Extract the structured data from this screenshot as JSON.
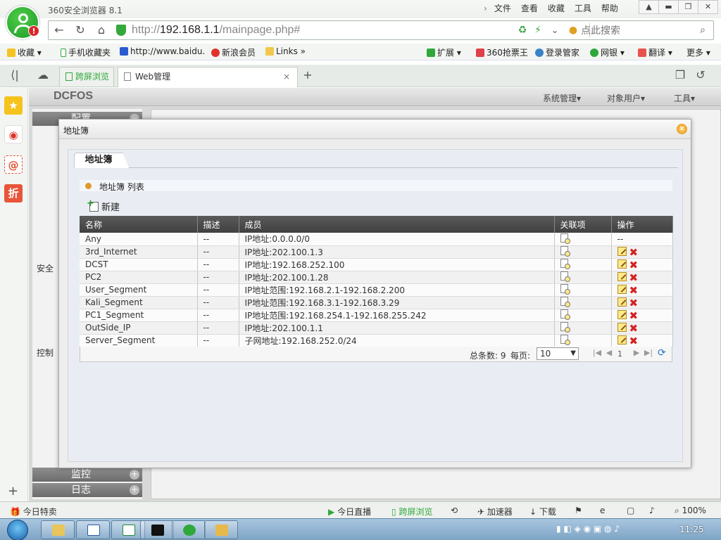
{
  "browser": {
    "title": "360安全浏览器 8.1",
    "menu": [
      "文件",
      "查看",
      "收藏",
      "工具",
      "帮助"
    ],
    "url_prefix": "http://",
    "url_host": "192.168.1.1",
    "url_path": "/mainpage.php#",
    "search_placeholder": "点此搜索"
  },
  "bookmarks": {
    "favorites": "收藏",
    "mobile": "手机收藏夹",
    "baidu": "http://www.baidu.",
    "sina": "新浪会员",
    "links": "Links",
    "extend": "扩展",
    "ticket": "360抢票王",
    "login": "登录管家",
    "bank": "网银",
    "translate": "翻译",
    "more": "更多"
  },
  "tabs": {
    "split": "跨屏浏览",
    "web": "Web管理"
  },
  "app": {
    "brand": "DCFOS",
    "menus": [
      "系统管理▾",
      "对象用户▾",
      "工具▾"
    ],
    "nav": {
      "config": "配置",
      "security": "安全",
      "control": "控制",
      "monitor": "监控",
      "log": "日志"
    }
  },
  "modal": {
    "title": "地址簿",
    "tab": "地址簿",
    "list_title": "地址簿 列表",
    "new_label": "新建",
    "columns": [
      "名称",
      "描述",
      "成员",
      "关联项",
      "操作"
    ],
    "rows": [
      {
        "name": "Any",
        "desc": "--",
        "member": "IP地址:0.0.0.0/0",
        "op": "--"
      },
      {
        "name": "3rd_Internet",
        "desc": "--",
        "member": "IP地址:202.100.1.3",
        "op": ""
      },
      {
        "name": "DCST",
        "desc": "--",
        "member": "IP地址:192.168.252.100",
        "op": ""
      },
      {
        "name": "PC2",
        "desc": "--",
        "member": "IP地址:202.100.1.28",
        "op": ""
      },
      {
        "name": "User_Segment",
        "desc": "--",
        "member": "IP地址范围:192.168.2.1-192.168.2.200",
        "op": ""
      },
      {
        "name": "Kali_Segment",
        "desc": "--",
        "member": "IP地址范围:192.168.3.1-192.168.3.29",
        "op": ""
      },
      {
        "name": "PC1_Segment",
        "desc": "--",
        "member": "IP地址范围:192.168.254.1-192.168.255.242",
        "op": ""
      },
      {
        "name": "OutSide_IP",
        "desc": "--",
        "member": "IP地址:202.100.1.1",
        "op": ""
      },
      {
        "name": "Server_Segment",
        "desc": "--",
        "member": "子网地址:192.168.252.0/24",
        "op": ""
      }
    ],
    "pager": {
      "total": "总条数: 9",
      "per_page_label": "每页:",
      "per_page": "10",
      "page": "1"
    }
  },
  "statusbar": {
    "today_deals": "今日特卖",
    "live": "今日直播",
    "split": "跨屏浏览",
    "accelerator": "加速器",
    "download": "下载",
    "zoom": "100%"
  },
  "taskbar": {
    "time": "11:25"
  },
  "colors": {
    "accent_green": "#2fa83a",
    "table_header": "#4a4a4a",
    "delete_red": "#d42222"
  }
}
